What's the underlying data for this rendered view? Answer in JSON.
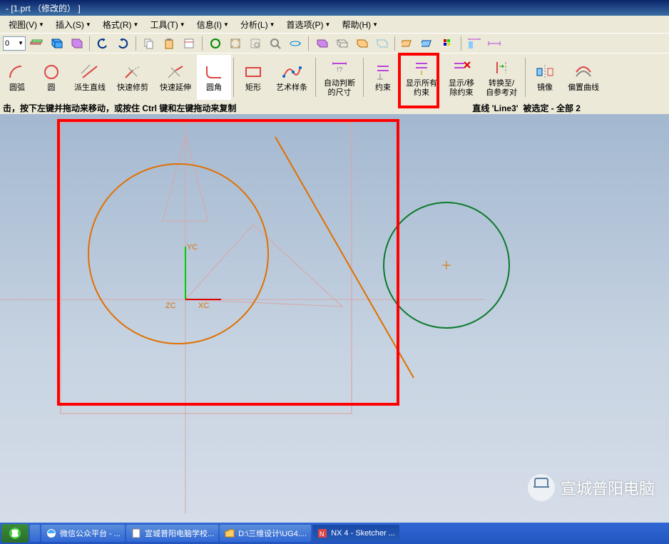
{
  "title": "- [1.prt （修改的） ]",
  "menus": {
    "view": "视图(V)",
    "insert": "插入(S)",
    "format": "格式(R)",
    "tools": "工具(T)",
    "info": "信息(I)",
    "analyze": "分析(L)",
    "prefs": "首选项(P)",
    "help": "帮助(H)"
  },
  "toolbar1_select": "0",
  "ribbon": {
    "arc": "圆弧",
    "circle": "圆",
    "derive": "派生直线",
    "trim": "快速修剪",
    "extend": "快速延伸",
    "fillet": "圆角",
    "rect": "矩形",
    "spline": "艺术样条",
    "autodim": "自动判断\n的尺寸",
    "constraint": "约束",
    "showall": "显示所有\n约束",
    "showremove": "显示/移\n除约束",
    "convert": "转换至/\n自参考对",
    "mirror": "镜像",
    "offset": "偏置曲线"
  },
  "status": {
    "left": "击，按下左键并拖动来移动，或按住 Ctrl 键和左键拖动来复制",
    "mid_a": "直线 'Line3'",
    "mid_b": "被选定 - 全部 2"
  },
  "axes": {
    "x": "XC",
    "y": "YC",
    "z": "ZC"
  },
  "watermark": "宣城普阳电脑",
  "taskbar": {
    "t1": "微信公众平台 - ...",
    "t2": "宣城普阳电脑学校...",
    "t3": "D:\\三维设计\\UG4....",
    "t4": "NX 4 - Sketcher ..."
  }
}
